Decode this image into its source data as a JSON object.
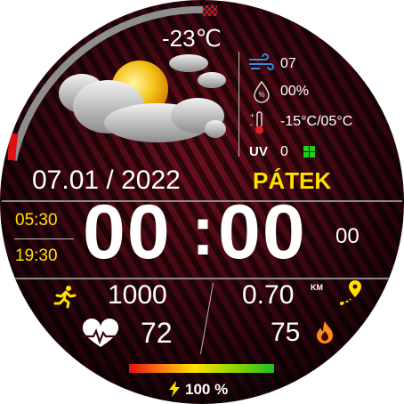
{
  "weather": {
    "temperature": "-23",
    "temperature_unit": "℃",
    "icon": "partly-cloudy-icon",
    "wind": "07",
    "humidity": "00%",
    "temp_range": "-15°C/05°C",
    "uv_label": "UV",
    "uv_value": "0"
  },
  "date": {
    "text": "07.01 / 2022",
    "weekday": "PÁTEK"
  },
  "sun": {
    "sunrise": "05:30",
    "sunset": "19:30"
  },
  "time": {
    "hours": "00",
    "separator": ":",
    "minutes": "00",
    "seconds": "00"
  },
  "stats": {
    "steps": "1000",
    "distance": "0.70",
    "distance_unit": "KM",
    "heart_rate": "72",
    "calories": "75"
  },
  "battery": {
    "level_percent": 100,
    "label": "100 %"
  },
  "colors": {
    "accent": "#ffe100",
    "arc_fill": "#e01010",
    "background": "#3c0710"
  }
}
